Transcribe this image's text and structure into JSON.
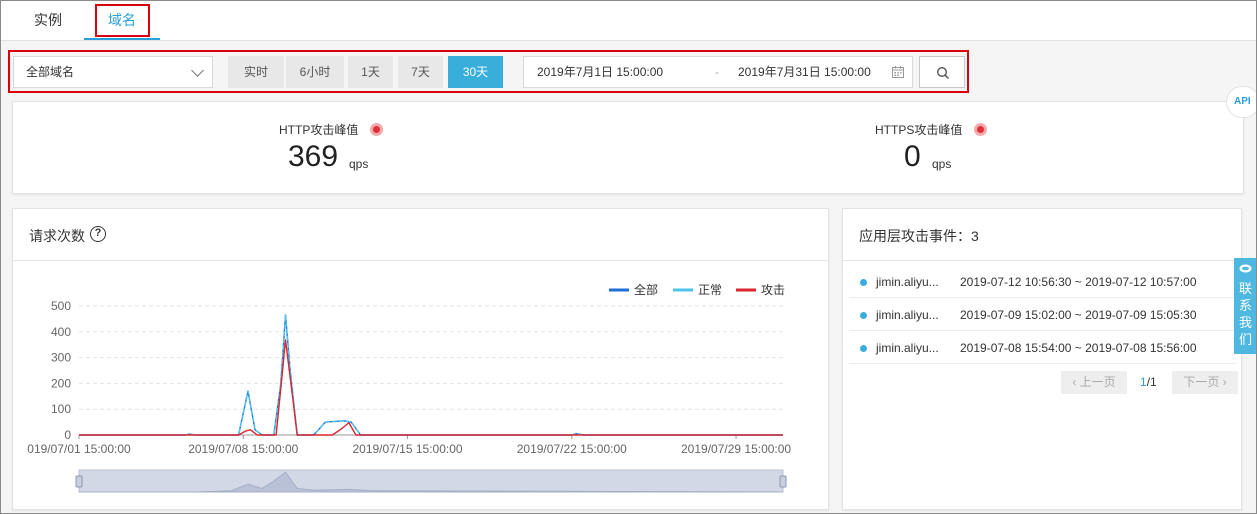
{
  "tabs": [
    {
      "label": "实例"
    },
    {
      "label": "域名"
    }
  ],
  "filter": {
    "domain_select": "全部域名",
    "ranges": [
      "实时",
      "6小时",
      "1天",
      "7天",
      "30天"
    ],
    "active_range": "30天",
    "date_start": "2019年7月1日 15:00:00",
    "date_separator": "-",
    "date_end": "2019年7月31日 15:00:00"
  },
  "peaks": {
    "http_label": "HTTP攻击峰值",
    "http_value": "369",
    "http_unit": "qps",
    "https_label": "HTTPS攻击峰值",
    "https_value": "0",
    "https_unit": "qps"
  },
  "api_badge": "API",
  "chart_card": {
    "title": "请求次数",
    "help": "?"
  },
  "chart_data": {
    "type": "line",
    "title": "",
    "xlabel": "",
    "ylabel": "",
    "ylim": [
      0,
      500
    ],
    "yticks": [
      0,
      100,
      200,
      300,
      400,
      500
    ],
    "xtick_labels": [
      "019/07/01 15:00:00",
      "2019/07/08 15:00:00",
      "2019/07/15 15:00:00",
      "2019/07/22 15:00:00",
      "2019/07/29 15:00:00"
    ],
    "x_range": [
      0,
      30
    ],
    "legend_position": "top-right",
    "grid": true,
    "series": [
      {
        "name": "全部",
        "color": "#1f6fd8",
        "points": [
          [
            0,
            0
          ],
          [
            4.5,
            0
          ],
          [
            4.7,
            3
          ],
          [
            5,
            0
          ],
          [
            6.8,
            0
          ],
          [
            7.2,
            170
          ],
          [
            7.5,
            20
          ],
          [
            7.8,
            0
          ],
          [
            8.3,
            0
          ],
          [
            8.6,
            200
          ],
          [
            8.8,
            465
          ],
          [
            9,
            250
          ],
          [
            9.3,
            0
          ],
          [
            10,
            0
          ],
          [
            10.5,
            50
          ],
          [
            11.3,
            55
          ],
          [
            11.6,
            50
          ],
          [
            12,
            0
          ],
          [
            21,
            0
          ],
          [
            21.2,
            5
          ],
          [
            21.5,
            0
          ],
          [
            30,
            0
          ]
        ]
      },
      {
        "name": "正常",
        "color": "#4fc3e8",
        "points": [
          [
            0,
            0
          ],
          [
            4.5,
            0
          ],
          [
            4.7,
            3
          ],
          [
            5,
            0
          ],
          [
            6.8,
            0
          ],
          [
            7.2,
            170
          ],
          [
            7.5,
            20
          ],
          [
            7.8,
            0
          ],
          [
            8.3,
            0
          ],
          [
            8.6,
            200
          ],
          [
            8.8,
            465
          ],
          [
            9,
            250
          ],
          [
            9.3,
            0
          ],
          [
            10,
            0
          ],
          [
            10.5,
            50
          ],
          [
            11.3,
            55
          ],
          [
            11.6,
            50
          ],
          [
            12,
            0
          ],
          [
            21,
            0
          ],
          [
            21.2,
            5
          ],
          [
            21.5,
            0
          ],
          [
            30,
            0
          ]
        ]
      },
      {
        "name": "攻击",
        "color": "#d9262f",
        "points": [
          [
            0,
            0
          ],
          [
            6.8,
            0
          ],
          [
            7.1,
            15
          ],
          [
            7.3,
            20
          ],
          [
            7.6,
            0
          ],
          [
            8.4,
            0
          ],
          [
            8.6,
            180
          ],
          [
            8.8,
            369
          ],
          [
            9.1,
            150
          ],
          [
            9.3,
            0
          ],
          [
            10.8,
            0
          ],
          [
            11.2,
            25
          ],
          [
            11.5,
            48
          ],
          [
            11.8,
            0
          ],
          [
            30,
            0
          ]
        ]
      }
    ],
    "overview_series": [
      [
        0,
        0
      ],
      [
        5,
        0
      ],
      [
        6.5,
        3
      ],
      [
        7.2,
        18
      ],
      [
        7.8,
        8
      ],
      [
        8.3,
        25
      ],
      [
        8.8,
        45
      ],
      [
        9.3,
        8
      ],
      [
        10,
        4
      ],
      [
        11.5,
        6
      ],
      [
        12.5,
        3
      ],
      [
        30,
        0
      ]
    ]
  },
  "events": {
    "title": "应用层攻击事件：3",
    "items": [
      {
        "domain": "jimin.aliyu...",
        "time": "2019-07-12 10:56:30 ~ 2019-07-12 10:57:00"
      },
      {
        "domain": "jimin.aliyu...",
        "time": "2019-07-09 15:02:00 ~ 2019-07-09 15:05:30"
      },
      {
        "domain": "jimin.aliyu...",
        "time": "2019-07-08 15:54:00 ~ 2019-07-08 15:56:00"
      }
    ],
    "pager": {
      "prev": "上一页",
      "next": "下一页",
      "current": "1",
      "total": "/1"
    }
  },
  "contact": {
    "label": "联系我们"
  }
}
